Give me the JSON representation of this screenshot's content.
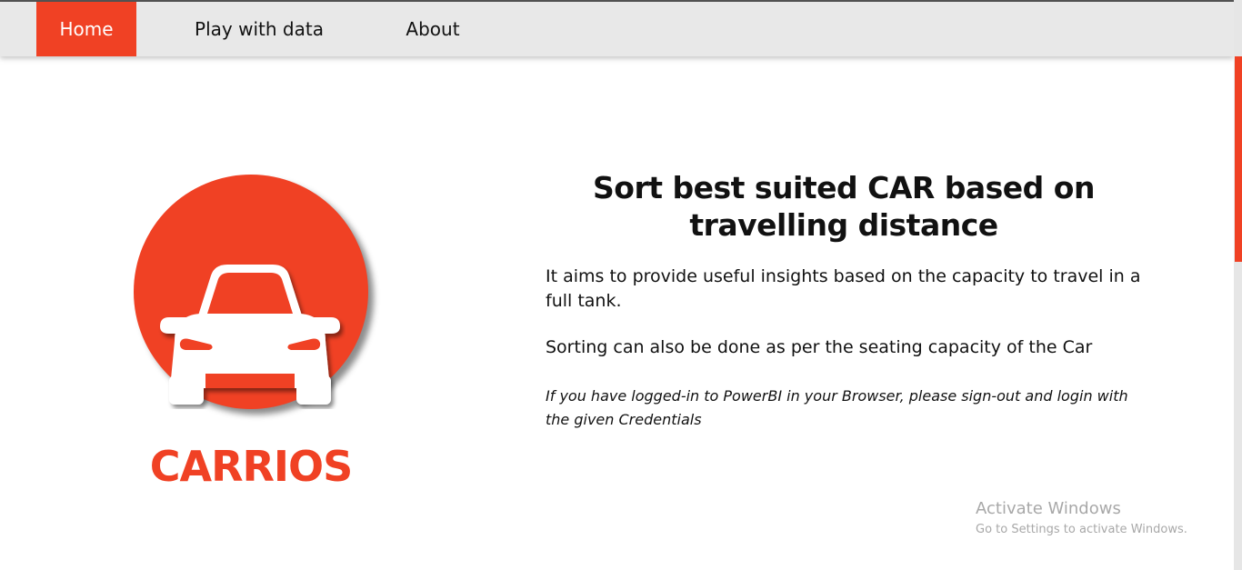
{
  "nav": {
    "items": [
      {
        "label": "Home",
        "active": true
      },
      {
        "label": "Play with data",
        "active": false
      },
      {
        "label": "About",
        "active": false
      }
    ]
  },
  "logo": {
    "icon": "car-icon",
    "brand": "CARRIOS"
  },
  "main": {
    "headline": "Sort best suited CAR based on travelling distance",
    "paragraph_1": "It aims to provide useful insights based on the capacity to travel in a full tank.",
    "paragraph_2": "Sorting can also be done as per the seating capacity of the Car",
    "note": "If you have logged-in to PowerBI in your Browser, please sign-out and login with the given Credentials"
  },
  "watermark": {
    "title": "Activate Windows",
    "subtitle": "Go to Settings to activate Windows."
  },
  "colors": {
    "accent": "#f04124",
    "navbar": "#e8e8e8",
    "text": "#111111"
  }
}
